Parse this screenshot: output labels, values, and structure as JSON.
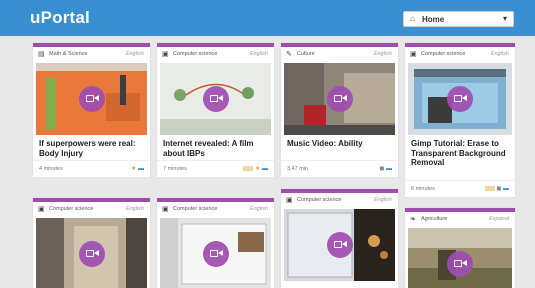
{
  "app": {
    "logo": "uPortal",
    "home_select": {
      "label": "Home",
      "icon": "home-icon",
      "caret": "▾"
    }
  },
  "colors": {
    "topbar": "#3a8fd0",
    "accent": "#a04db0",
    "background": "#e8e8e8"
  },
  "cards": [
    {
      "category": "Math & Science",
      "lang": "English",
      "title": "If superpowers were real: Body Injury",
      "minutes": "4 minutes",
      "icon": "book-icon",
      "thumb": "orange-classroom"
    },
    {
      "category": "Computer science",
      "lang": "English",
      "title": "Internet revealed: A film about IBPs",
      "minutes": "7 minutes",
      "icon": "computer-icon",
      "thumb": "whiteboard"
    },
    {
      "category": "Culture",
      "lang": "English",
      "title": "Music Video: Ability",
      "minutes": "3.47 min",
      "icon": "culture-icon",
      "thumb": "street-video"
    },
    {
      "category": "Computer science",
      "lang": "English",
      "title": "Gimp Tutorial: Erase to Transparent Background Removal",
      "minutes": "6 minutes",
      "icon": "computer-icon",
      "thumb": "gimp-window"
    },
    {
      "category": "Computer science",
      "lang": "English",
      "title": "",
      "minutes": "",
      "icon": "computer-icon",
      "thumb": "doorway"
    },
    {
      "category": "Computer science",
      "lang": "English",
      "title": "",
      "minutes": "",
      "icon": "computer-icon",
      "thumb": "desktop-screen"
    },
    {
      "category": "Computer science",
      "lang": "English",
      "title": "",
      "minutes": "",
      "icon": "computer-icon",
      "thumb": "night-scene"
    },
    {
      "category": "Agriculture",
      "lang": "Espanol",
      "title": "",
      "minutes": "",
      "icon": "leaf-icon",
      "thumb": "field"
    }
  ]
}
